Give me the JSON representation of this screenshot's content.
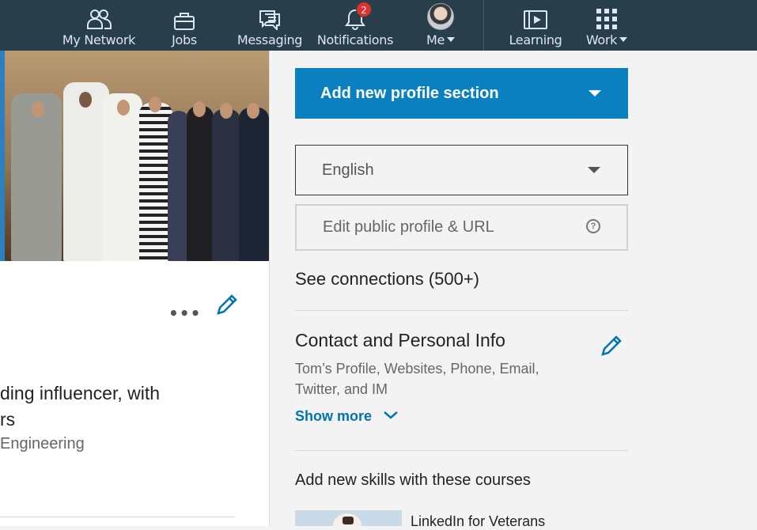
{
  "nav": {
    "items": [
      {
        "label": "My Network",
        "icon": "people-icon"
      },
      {
        "label": "Jobs",
        "icon": "briefcase-icon"
      },
      {
        "label": "Messaging",
        "icon": "chat-icon"
      },
      {
        "label": "Notifications",
        "icon": "bell-icon",
        "badge": "2"
      },
      {
        "label": "Me",
        "icon": "avatar"
      },
      {
        "label": "Learning",
        "icon": "play-icon"
      },
      {
        "label": "Work",
        "icon": "grid-icon"
      }
    ],
    "colors": {
      "background": "#283e4a",
      "badge": "#e0302b"
    }
  },
  "profile": {
    "headline_line1": "ding influencer, with",
    "headline_line2": "rs",
    "subline": "Engineering"
  },
  "sidebar": {
    "add_section_label": "Add new profile section",
    "language_value": "English",
    "edit_public_label": "Edit public profile & URL",
    "connections_label": "See connections (500+)",
    "contact": {
      "title": "Contact and Personal Info",
      "description": "Tom’s Profile, Websites, Phone, Email, Twitter, and IM",
      "show_more": "Show more"
    },
    "skills_title": "Add new skills with these courses",
    "course_title": "LinkedIn for Veterans"
  },
  "colors": {
    "accent": "#0a80c0",
    "link": "#0073b1"
  }
}
